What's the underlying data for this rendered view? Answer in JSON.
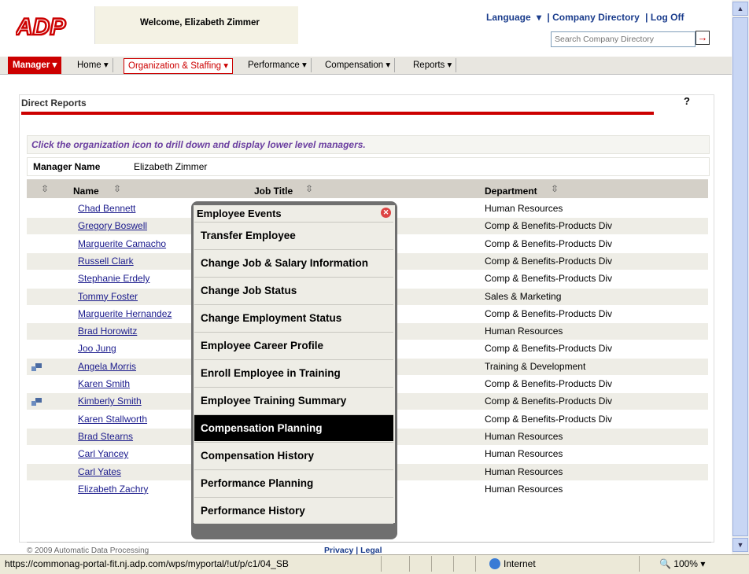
{
  "header": {
    "logo": "ADP",
    "welcome": "Welcome, Elizabeth Zimmer",
    "language": "Language",
    "company_directory": "| Company Directory",
    "logout": "| Log Off",
    "search_placeholder": "Search Company Directory"
  },
  "nav": {
    "manager": "Manager ▾",
    "items": [
      "Home ▾",
      "Organization & Staffing ▾",
      "Performance ▾",
      "Compensation ▾",
      "Reports ▾"
    ]
  },
  "page": {
    "title": "Direct Reports",
    "help": "?",
    "instruction": "Click the organization icon to drill down and display lower level managers.",
    "manager_label": "Manager Name",
    "manager_value": "Elizabeth Zimmer"
  },
  "table": {
    "headers": {
      "name": "Name",
      "job_title": "Job Title",
      "department": "Department"
    },
    "rows": [
      {
        "name": "Chad Bennett",
        "dept": "Human Resources",
        "org": false
      },
      {
        "name": "Gregory Boswell",
        "dept": "Comp & Benefits-Products Div",
        "org": false
      },
      {
        "name": "Marguerite Camacho",
        "dept": "Comp & Benefits-Products Div",
        "org": false
      },
      {
        "name": "Russell Clark",
        "dept": "Comp & Benefits-Products Div",
        "org": false
      },
      {
        "name": "Stephanie Erdely",
        "dept": "Comp & Benefits-Products Div",
        "org": false
      },
      {
        "name": "Tommy Foster",
        "dept": "Sales & Marketing",
        "org": false
      },
      {
        "name": "Marguerite Hernandez",
        "dept": "Comp & Benefits-Products Div",
        "org": false
      },
      {
        "name": "Brad Horowitz",
        "dept": "Human Resources",
        "org": false
      },
      {
        "name": "Joo Jung",
        "dept": "Comp & Benefits-Products Div",
        "org": false
      },
      {
        "name": "Angela Morris",
        "dept": "Training & Development",
        "org": true
      },
      {
        "name": "Karen Smith",
        "dept": "Comp & Benefits-Products Div",
        "org": false
      },
      {
        "name": "Kimberly Smith",
        "dept": "Comp & Benefits-Products Div",
        "org": true
      },
      {
        "name": "Karen Stallworth",
        "dept": "Comp & Benefits-Products Div",
        "org": false
      },
      {
        "name": "Brad Stearns",
        "dept": "Human Resources",
        "org": false
      },
      {
        "name": "Carl Yancey",
        "dept": "Human Resources",
        "org": false
      },
      {
        "name": "Carl Yates",
        "dept": "Human Resources",
        "org": false
      },
      {
        "name": "Elizabeth Zachry",
        "dept": "Human Resources",
        "org": false
      }
    ]
  },
  "popup": {
    "title": "Employee Events",
    "items": [
      "Transfer Employee",
      "Change Job & Salary Information",
      "Change Job Status",
      "Change Employment Status",
      "Employee Career Profile",
      "Enroll Employee in Training",
      "Employee Training Summary",
      "Compensation Planning",
      "Compensation History",
      "Performance Planning",
      "Performance History"
    ],
    "highlighted_index": 7
  },
  "footer": {
    "copyright": "© 2009 Automatic Data Processing",
    "privacy": "Privacy  |  Legal"
  },
  "statusbar": {
    "url": "https://commonag-portal-fit.nj.adp.com/wps/myportal/!ut/p/c1/04_SB",
    "zone": "Internet",
    "zoom": "100%"
  },
  "colors": {
    "brand_red": "#cc0000",
    "link_blue": "#1a3c8c",
    "highlight": "#000000"
  }
}
